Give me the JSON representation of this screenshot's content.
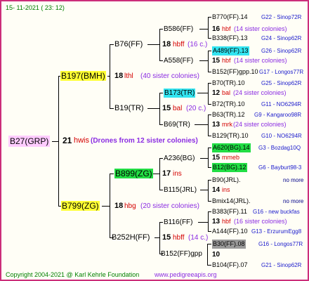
{
  "header": {
    "date": "15- 11-2021 ( 23: 12)"
  },
  "footer": {
    "copyright": "Copyright 2004-2021 @ Karl Kehrle Foundation",
    "website": "www.pedigreeapis.org"
  },
  "root": {
    "label": "B27(GRP)",
    "gen": "21",
    "code": "hwis",
    "colonies": "(Drones from 12 sister colonies)"
  },
  "gen1": [
    {
      "label": "B197(BMH)",
      "gen": "18",
      "code": "lthl",
      "colonies": "(40 sister colonies)"
    },
    {
      "label": "B799(ZG)",
      "gen": "18",
      "code": "hbg",
      "colonies": "(20 sister colonies)"
    }
  ],
  "gen2": [
    {
      "label": "B76(FF)",
      "gen": "18",
      "code": "hbff",
      "colonies": "(16 c.)"
    },
    {
      "label": "B19(TR)",
      "gen": "15",
      "code": "bal",
      "colonies": "(20 c.)"
    },
    {
      "label": "B899(ZG)",
      "gen": "17",
      "code": "ins",
      "colonies": ""
    },
    {
      "label": "B252H(FF)",
      "gen": "15",
      "code": "hbff",
      "colonies": "(14 c.)"
    }
  ],
  "gen3": [
    {
      "label": "B586(FF)"
    },
    {
      "label": "A558(FF)"
    },
    {
      "label": "B173(TR)"
    },
    {
      "label": "B69(TR)"
    },
    {
      "label": "A236(BG)"
    },
    {
      "label": "B115(JRL)"
    },
    {
      "label": "B116(FF)"
    },
    {
      "label": "B152(FF)gpp"
    }
  ],
  "gen3_info": [
    {
      "gen": "18",
      "code": "hbff",
      "colonies": "(16 c.)"
    },
    {
      "gen": "12",
      "code": "bal",
      "colonies": "(24 sister colonies)"
    },
    {
      "gen": "15",
      "code": "mmeb",
      "colonies": ""
    },
    {
      "gen": "10",
      "code": "",
      "colonies": ""
    }
  ],
  "gen4": [
    {
      "label": "B770(FF).14",
      "ref": "G22 - Sinop72R"
    },
    {
      "label": "B338(FF).13",
      "ref": "G24 - Sinop62R"
    },
    {
      "label": "A489(FF).13",
      "ref": "G26 - Sinop62R"
    },
    {
      "label": "B152(FF)gpp.10",
      "ref": "G17 - Longos77R"
    },
    {
      "label": "B70(TR).10",
      "ref": "G25 - Sinop62R"
    },
    {
      "label": "B72(TR).10",
      "ref": "G11 - NO6294R"
    },
    {
      "label": "B63(TR).12",
      "ref": "G9 - Kangaroo98R"
    },
    {
      "label": "B129(TR).10",
      "ref": "G10 - NO6294R"
    },
    {
      "label": "A620(BG).14",
      "ref": "G3 - Bozdag10Q"
    },
    {
      "label": "B12(BG).12",
      "ref": "G6 - Bayburt98-3"
    },
    {
      "label": "B90(JRL).",
      "ref": "no more"
    },
    {
      "label": "Bmix14(JRL).",
      "ref": "no more"
    },
    {
      "label": "B383(FF).11",
      "ref": "G16 - new buckfas"
    },
    {
      "label": "A144(FF).10",
      "ref": "G13 - ErzurumEgg8"
    },
    {
      "label": "B30(FF).08",
      "ref": "G16 - Longos77R"
    },
    {
      "label": "B104(FF).07",
      "ref": "G21 - Sinop62R"
    }
  ],
  "gen4_info": [
    {
      "gen": "16",
      "code": "hbf",
      "colonies": "(14 sister colonies)"
    },
    {
      "gen": "15",
      "code": "hbf",
      "colonies": "(14 sister colonies)"
    },
    {
      "gen": "12",
      "code": "bal",
      "colonies": "(24 sister colonies)"
    },
    {
      "gen": "13",
      "code": "mrk",
      "colonies": "(24 sister colonies)"
    },
    {
      "gen": "15",
      "code": "mmeb",
      "colonies": ""
    },
    {
      "gen": "14",
      "code": "ins",
      "colonies": ""
    },
    {
      "gen": "13",
      "code": "hbf",
      "colonies": "(16 sister colonies)"
    },
    {
      "gen": "10",
      "code": "",
      "colonies": ""
    }
  ],
  "colors": {
    "frame": "#cc2e7a",
    "yellow": "#ffff33",
    "cyan": "#33e4f0",
    "green": "#22dd44",
    "gray": "#9a9a9a",
    "red": "#d40000",
    "purple": "#8a2be2",
    "blue": "#1a1acc"
  }
}
